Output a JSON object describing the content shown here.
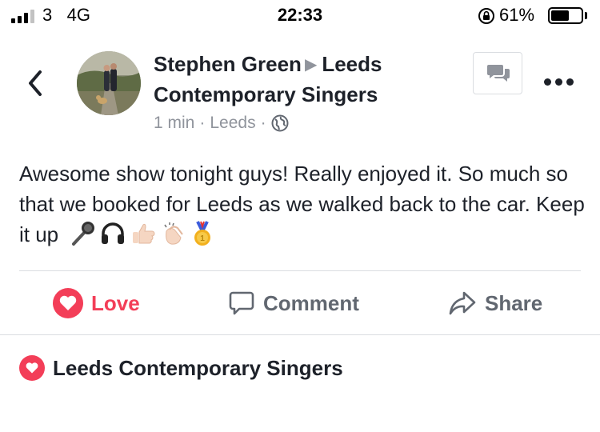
{
  "status_bar": {
    "carrier": "3",
    "network": "4G",
    "time": "22:33",
    "battery_percent": "61%",
    "battery_level": 0.61,
    "signal_bars": 3,
    "icons": [
      "signal-icon",
      "orientation-lock-icon",
      "battery-icon"
    ]
  },
  "post": {
    "author": "Stephen Green",
    "arrow": "▶",
    "group": "Leeds Contemporary Singers",
    "time": "1 min",
    "location": "Leeds",
    "separator": "·",
    "privacy_icon": "globe-icon",
    "body": "Awesome show tonight guys! Really enjoyed it. So much so that we booked for Leeds as we walked back to the car. Keep it up",
    "emojis": [
      "microphone-emoji",
      "headphones-emoji",
      "thumbs-up-emoji",
      "clapping-hands-emoji",
      "medal-emoji"
    ]
  },
  "actions": {
    "love_label": "Love",
    "comment_label": "Comment",
    "share_label": "Share"
  },
  "reactions": {
    "label": "Leeds Contemporary Singers"
  },
  "colors": {
    "love_red": "#f33e58",
    "text_dark": "#1d2129",
    "text_muted": "#90949c",
    "action_gray": "#616770",
    "divider": "#dadde1"
  }
}
